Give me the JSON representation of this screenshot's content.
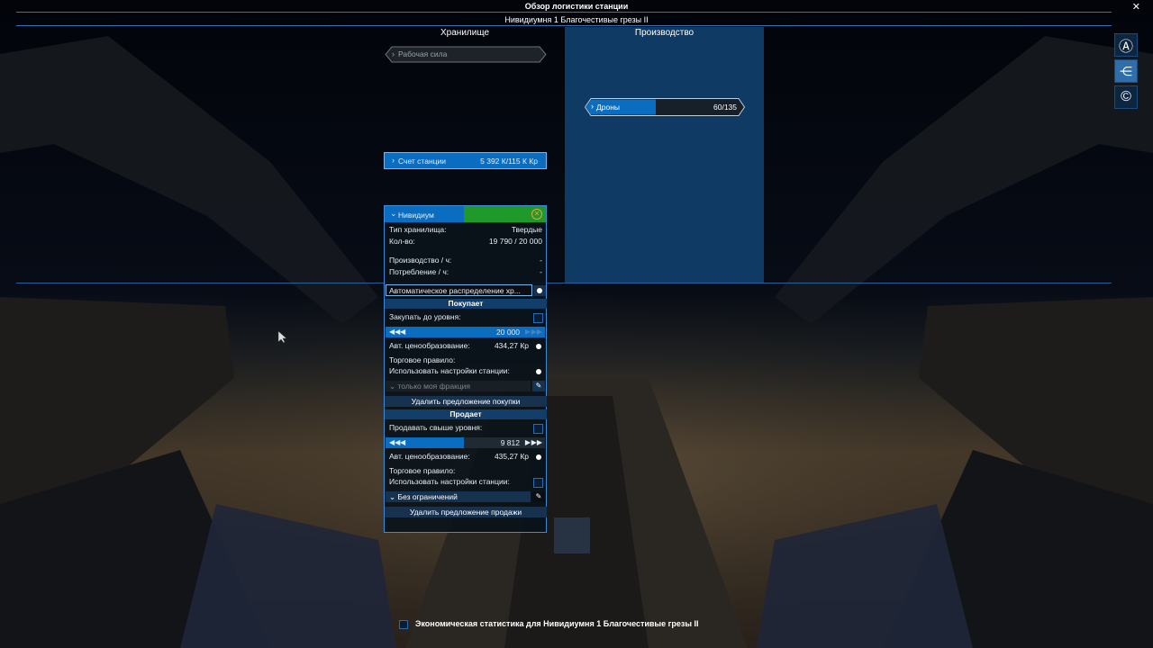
{
  "header": {
    "title": "Обзор логистики станции",
    "subtitle": "Нивидиумня 1 Благочестивые грезы II",
    "close_glyph": "✕"
  },
  "storage": {
    "title": "Хранилище",
    "workforce_label": "Рабочая сила",
    "account_label": "Счет станции",
    "account_value": "5 392 К/115 К Кр"
  },
  "production": {
    "title": "Производство",
    "drones_label": "Дроны",
    "drones_value": "60/135",
    "drones_fraction": 0.44
  },
  "ware": {
    "name": "Нивидиум",
    "storage_type_label": "Тип хранилища:",
    "storage_type_value": "Твердые",
    "amount_label": "Кол-во:",
    "amount_value": "19 790 / 20 000",
    "amount_fraction": 0.9895,
    "production_label": "Производство / ч:",
    "production_value": "-",
    "consumption_label": "Потребление / ч:",
    "consumption_value": "-",
    "auto_alloc_label": "Автоматическое распределение хр..."
  },
  "buy": {
    "header": "Покупает",
    "buy_until_label": "Закупать до уровня:",
    "slider_value": "20 000",
    "auto_price_label": "Авт. ценообразование:",
    "auto_price_value": "434,27 Кр",
    "trade_rule_label": "Торговое правило:",
    "use_station_label": "Использовать настройки станции:",
    "faction_label": "только моя фракция",
    "delete_label": "Удалить предложение покупки"
  },
  "sell": {
    "header": "Продает",
    "sell_above_label": "Продавать свыше уровня:",
    "slider_value": "9 812",
    "slider_fraction": 0.49,
    "auto_price_label": "Авт. ценообразование:",
    "auto_price_value": "435,27 Кр",
    "trade_rule_label": "Торговое правило:",
    "use_station_label": "Использовать настройки станции:",
    "restriction_label": "Без ограничений",
    "delete_label": "Удалить предложение продажи"
  },
  "footer": {
    "stats_label": "Экономическая статистика для Нивидиумня 1 Благочестивые грезы II"
  },
  "side_buttons": [
    {
      "icon": "autopilot-icon",
      "glyph": "Ⓐ"
    },
    {
      "icon": "network-icon",
      "glyph": "⋲"
    },
    {
      "icon": "credits-icon",
      "glyph": "©"
    }
  ],
  "colors": {
    "accent": "#0a6dc0",
    "panel": "#0e3a64",
    "green": "#1f9a2a",
    "dark": "#1f2a33"
  }
}
